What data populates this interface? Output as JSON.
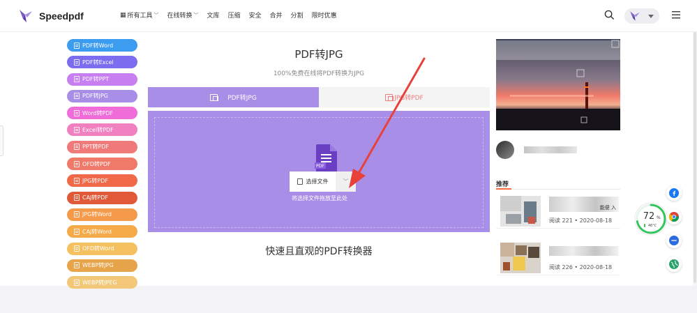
{
  "header": {
    "logo_text": "Speedpdf",
    "nav": [
      {
        "label": "所有工具",
        "has_grid": true,
        "has_dropdown": true
      },
      {
        "label": "在线转换",
        "has_dropdown": true
      },
      {
        "label": "文库"
      },
      {
        "label": "压缩"
      },
      {
        "label": "安全"
      },
      {
        "label": "合并"
      },
      {
        "label": "分割"
      },
      {
        "label": "限时优惠"
      }
    ],
    "icons": [
      "search-icon",
      "user-avatar",
      "menu-icon"
    ]
  },
  "sidebar": {
    "items": [
      {
        "label": "PDF转Word",
        "color": "#3b9cf0"
      },
      {
        "label": "PDF转Excel",
        "color": "#7b6cf0"
      },
      {
        "label": "PDF转PPT",
        "color": "#c77ef0"
      },
      {
        "label": "PDF转JPG",
        "color": "#a88ee6"
      },
      {
        "label": "Word转PDF",
        "color": "#f06cd8"
      },
      {
        "label": "Excel转PDF",
        "color": "#f080c0"
      },
      {
        "label": "PPT转PDF",
        "color": "#f07a7a"
      },
      {
        "label": "OFD转PDF",
        "color": "#f07a6a"
      },
      {
        "label": "JPG转PDF",
        "color": "#f06a4a"
      },
      {
        "label": "CAJ转PDF",
        "color": "#e05a3a"
      },
      {
        "label": "JPG转Word",
        "color": "#f59a4a"
      },
      {
        "label": "CAJ转Word",
        "color": "#f5aa4a"
      },
      {
        "label": "OFD转Word",
        "color": "#f5c060"
      },
      {
        "label": "WEBP转JPG",
        "color": "#e8a44a"
      },
      {
        "label": "WEBP转JPEG",
        "color": "#f2c878"
      }
    ]
  },
  "main": {
    "title": "PDF转JPG",
    "subtitle": "100%免费在线将PDF转换为JPG",
    "tabs": [
      {
        "label": "PDF转JPG",
        "active": true
      },
      {
        "label": "JPG转PDF",
        "active": false
      }
    ],
    "choose_file_label": "选择文件",
    "drop_hint": "将选择文件拖放至此处",
    "slogan": "快速且直观的PDF转换器",
    "accent_color": "#a88ee6"
  },
  "right": {
    "recommend_title": "推荐",
    "items": [
      {
        "title_visible": "能便\n入",
        "reads": "阅读 221",
        "date": "2020-08-18"
      },
      {
        "title_visible": "",
        "reads": "阅读 226",
        "date": "2020-08-18"
      }
    ]
  },
  "widget": {
    "percent": "72",
    "percent_unit": "%",
    "temp": "46°C",
    "gauge_fraction": 0.72
  },
  "social": [
    "facebook-icon",
    "chrome-icon",
    "messenger-icon",
    "globe-icon"
  ]
}
